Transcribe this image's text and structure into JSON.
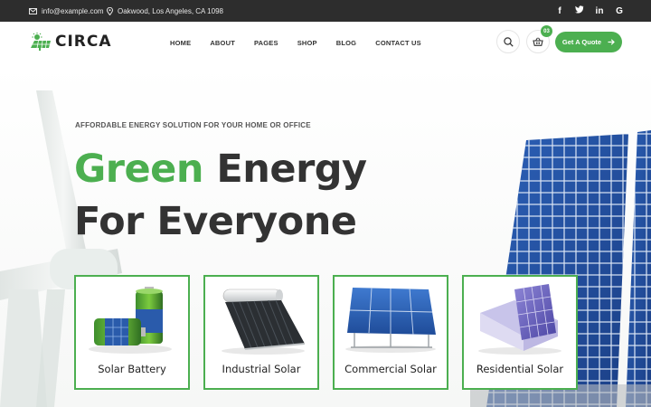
{
  "topbar": {
    "email": "info@example.com",
    "address": "Oakwood, Los Angeles, CA 1098",
    "socials": [
      {
        "icon": "facebook-icon",
        "glyph": "f"
      },
      {
        "icon": "twitter-icon",
        "glyph": "t"
      },
      {
        "icon": "linkedin-icon",
        "glyph": "in"
      },
      {
        "icon": "google-icon",
        "glyph": "G"
      }
    ]
  },
  "header": {
    "logo_text": "CIRCA",
    "nav": [
      "HOME",
      "ABOUT",
      "PAGES",
      "SHOP",
      "BLOG",
      "CONTACT US"
    ],
    "cart_count": "03",
    "quote_label": "Get A Quote"
  },
  "hero": {
    "tagline": "AFFORDABLE ENERGY SOLUTION FOR YOUR HOME OR OFFICE",
    "headline_green": "Green",
    "headline_rest_1": " Energy",
    "headline_line2": "For Everyone"
  },
  "cards": [
    {
      "label": "Solar Battery"
    },
    {
      "label": "Industrial Solar"
    },
    {
      "label": "Commercial Solar"
    },
    {
      "label": "Residential Solar"
    }
  ],
  "colors": {
    "accent": "#4caf50",
    "topbar": "#2d2d2d",
    "text_dark": "#333333"
  }
}
